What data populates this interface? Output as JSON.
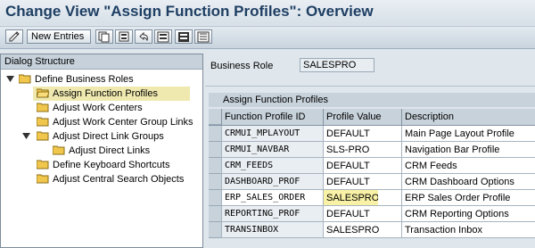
{
  "title": "Change View \"Assign Function Profiles\": Overview",
  "toolbar": {
    "new_entries_label": "New Entries",
    "icons": [
      "edit-icon",
      "copy-icon",
      "delete-icon",
      "undo-icon",
      "select-all-icon",
      "select-block-icon",
      "deselect-icon"
    ]
  },
  "dialog": {
    "header": "Dialog Structure",
    "items": [
      {
        "label": "Define Business Roles"
      },
      {
        "label": "Assign Function Profiles"
      },
      {
        "label": "Adjust Work Centers"
      },
      {
        "label": "Adjust Work Center Group Links"
      },
      {
        "label": "Adjust Direct Link Groups"
      },
      {
        "label": "Adjust Direct Links"
      },
      {
        "label": "Define Keyboard Shortcuts"
      },
      {
        "label": "Adjust Central Search Objects"
      }
    ]
  },
  "business_role": {
    "label": "Business Role",
    "value": "SALESPRO"
  },
  "table": {
    "title": "Assign Function Profiles",
    "headers": [
      "Function Profile ID",
      "Profile Value",
      "Description"
    ],
    "rows": [
      {
        "id": "CRMUI_MPLAYOUT",
        "value": "DEFAULT",
        "desc": "Main Page Layout Profile"
      },
      {
        "id": "CRMUI_NAVBAR",
        "value": "SLS-PRO",
        "desc": "Navigation Bar Profile"
      },
      {
        "id": "CRM_FEEDS",
        "value": "DEFAULT",
        "desc": "CRM Feeds"
      },
      {
        "id": "DASHBOARD_PROF",
        "value": "DEFAULT",
        "desc": "CRM Dashboard Options"
      },
      {
        "id": "ERP_SALES_ORDER",
        "value": "SALESPRO",
        "desc": "ERP Sales Order Profile"
      },
      {
        "id": "REPORTING_PROF",
        "value": "DEFAULT",
        "desc": "CRM Reporting Options"
      },
      {
        "id": "TRANSINBOX",
        "value": "SALESPRO",
        "desc": "Transaction Inbox"
      }
    ]
  }
}
